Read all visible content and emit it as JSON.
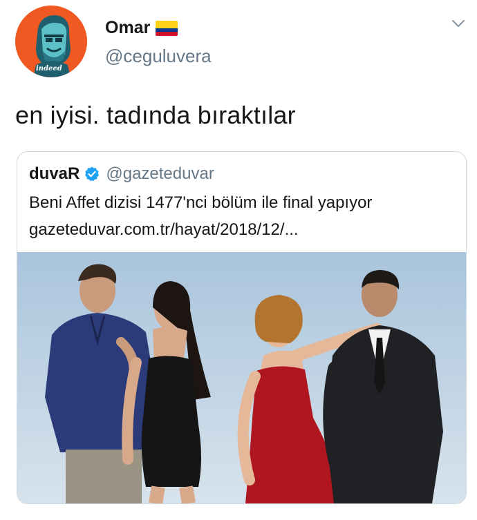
{
  "author": {
    "name": "Omar",
    "handle": "@ceguluvera",
    "avatar_icon": "avatar-illustration-icon",
    "avatar_caption": "indeed",
    "flag_colors": [
      "#fcd116",
      "#003893",
      "#ce1126"
    ]
  },
  "tweet": {
    "text": "en iyisi. tadında bıraktılar"
  },
  "quoted": {
    "name": "duvaR",
    "handle": "@gazeteduvar",
    "line1": "Beni Affet dizisi 1477'nci bölüm ile final yapıyor",
    "line2": "gazeteduvar.com.tr/hayat/2018/12/...",
    "image_icon": "cast-photo-icon"
  },
  "colors": {
    "avatar_bg": "#f05a22",
    "secondary_text": "#657786",
    "verified": "#1da1f2"
  }
}
